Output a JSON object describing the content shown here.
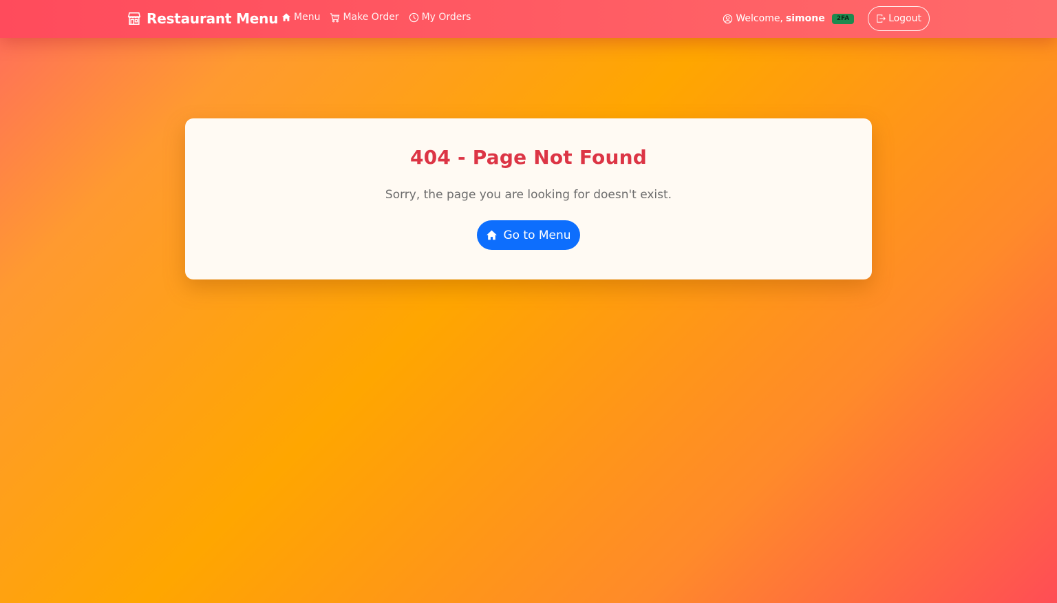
{
  "navbar": {
    "brand": {
      "icon": "shop-icon",
      "label": "Restaurant Menu"
    },
    "links": [
      {
        "icon": "house-icon",
        "label": "Menu"
      },
      {
        "icon": "cart-icon",
        "label": "Make Order"
      },
      {
        "icon": "clock-icon",
        "label": "My Orders"
      }
    ],
    "user": {
      "icon": "person-circle-icon",
      "greeting": "Welcome,",
      "username": "simone",
      "badge": "2FA",
      "badge_color": "#1d8a4f"
    },
    "logout": {
      "icon": "logout-icon",
      "label": "Logout"
    }
  },
  "error": {
    "title": "404 - Page Not Found",
    "message": "Sorry, the page you are looking for doesn't exist.",
    "button": {
      "icon": "house-icon",
      "label": "Go to Menu"
    },
    "title_color": "#dc3545",
    "button_color": "#0d6efd"
  }
}
